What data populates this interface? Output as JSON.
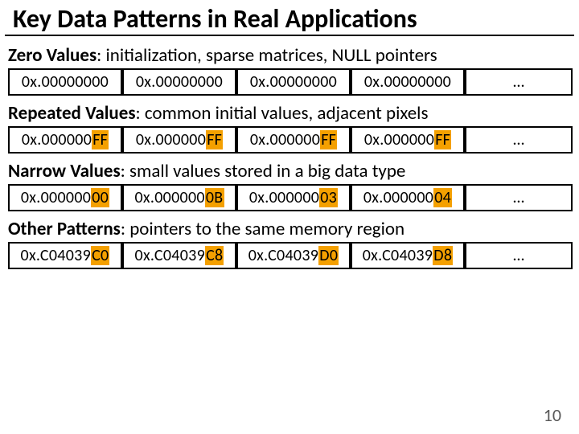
{
  "title": "Key Data Patterns in Real Applications",
  "page_number": "10",
  "sections": [
    {
      "name": "Zero Values",
      "desc": ": initialization,  sparse matrices, NULL pointers",
      "cells": [
        {
          "pre": "0x.",
          "hl": "",
          "post": "00000000"
        },
        {
          "pre": "0x.",
          "hl": "",
          "post": "00000000"
        },
        {
          "pre": "0x.",
          "hl": "",
          "post": "00000000"
        },
        {
          "pre": "0x.",
          "hl": "",
          "post": "00000000"
        }
      ],
      "ellipsis": "…"
    },
    {
      "name": "Repeated Values",
      "desc": ": common initial values, adjacent pixels",
      "cells": [
        {
          "pre": "0x.000000",
          "hl": "FF",
          "post": ""
        },
        {
          "pre": "0x.000000",
          "hl": "FF",
          "post": ""
        },
        {
          "pre": "0x.000000",
          "hl": "FF",
          "post": ""
        },
        {
          "pre": "0x.000000",
          "hl": "FF",
          "post": ""
        }
      ],
      "ellipsis": "…"
    },
    {
      "name": "Narrow Values",
      "desc": ": small values stored in a big data type",
      "cells": [
        {
          "pre": "0x.000000",
          "hl": "00",
          "post": ""
        },
        {
          "pre": "0x.000000",
          "hl": "0B",
          "post": ""
        },
        {
          "pre": "0x.000000",
          "hl": "03",
          "post": ""
        },
        {
          "pre": "0x.000000",
          "hl": "04",
          "post": ""
        }
      ],
      "ellipsis": "…"
    },
    {
      "name": "Other Patterns",
      "desc": ": pointers to the same memory region",
      "cells": [
        {
          "pre": "0x.C04039",
          "hl": "C0",
          "post": ""
        },
        {
          "pre": "0x.C04039",
          "hl": "C8",
          "post": ""
        },
        {
          "pre": "0x.C04039",
          "hl": "D0",
          "post": ""
        },
        {
          "pre": "0x.C04039",
          "hl": "D8",
          "post": ""
        }
      ],
      "ellipsis": "…"
    }
  ]
}
